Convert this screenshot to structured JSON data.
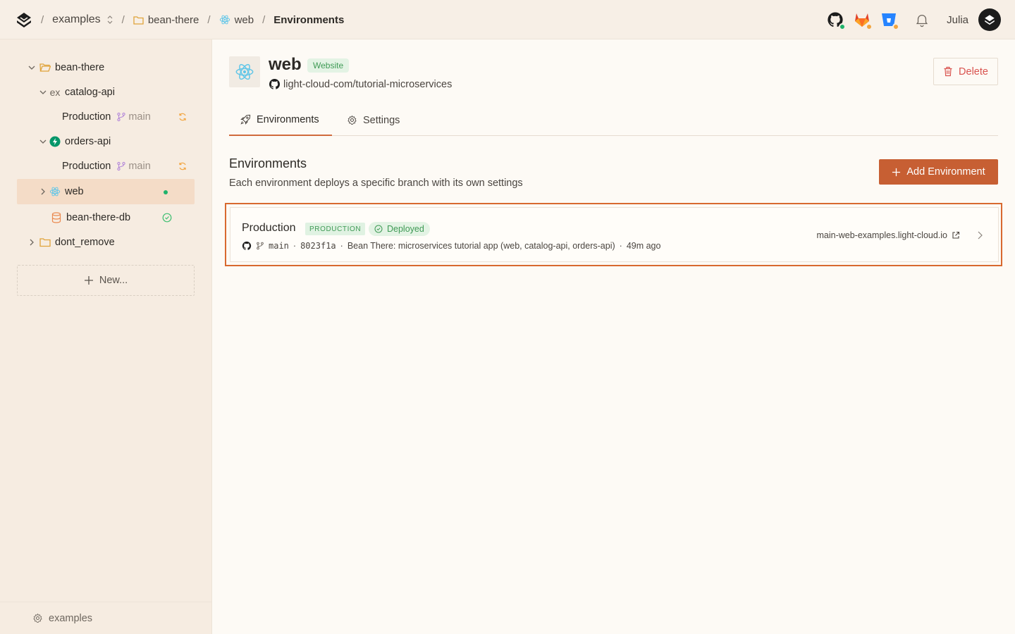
{
  "breadcrumb": {
    "org": "examples",
    "project": "bean-there",
    "service": "web",
    "current": "Environments",
    "separator": "/"
  },
  "user": {
    "name": "Julia"
  },
  "sidebar": {
    "tree": [
      {
        "label": "bean-there",
        "type": "project",
        "expanded": true
      },
      {
        "label": "catalog-api",
        "type": "service",
        "icon_prefix": "ex",
        "expanded": true
      },
      {
        "label": "Production",
        "type": "environment",
        "branch": "main",
        "status": "syncing"
      },
      {
        "label": "orders-api",
        "type": "service",
        "expanded": true
      },
      {
        "label": "Production",
        "type": "environment",
        "branch": "main",
        "status": "syncing"
      },
      {
        "label": "web",
        "type": "service",
        "selected": true,
        "status": "online"
      },
      {
        "label": "bean-there-db",
        "type": "database",
        "status": "healthy"
      },
      {
        "label": "dont_remove",
        "type": "project",
        "expanded": false
      }
    ],
    "new_label": "New...",
    "footer_label": "examples"
  },
  "service": {
    "name": "web",
    "badge": "Website",
    "repo": "light-cloud-com/tutorial-microservices",
    "delete_label": "Delete"
  },
  "tabs": [
    {
      "label": "Environments",
      "active": true
    },
    {
      "label": "Settings",
      "active": false
    }
  ],
  "environments_section": {
    "title": "Environments",
    "subtitle": "Each environment deploys a specific branch with its own settings",
    "add_label": "Add Environment"
  },
  "environment_card": {
    "name": "Production",
    "tag": "PRODUCTION",
    "status": "Deployed",
    "branch": "main",
    "commit": "8023f1a",
    "commit_message": "Bean There: microservices tutorial app (web, catalog-api, orders-api)",
    "time": "49m ago",
    "url": "main-web-examples.light-cloud.io"
  },
  "colors": {
    "accent": "#c75f33",
    "highlight": "#d8692f",
    "success": "#3f9a55",
    "folder": "#e0a33a",
    "branch": "#b58ad9"
  }
}
